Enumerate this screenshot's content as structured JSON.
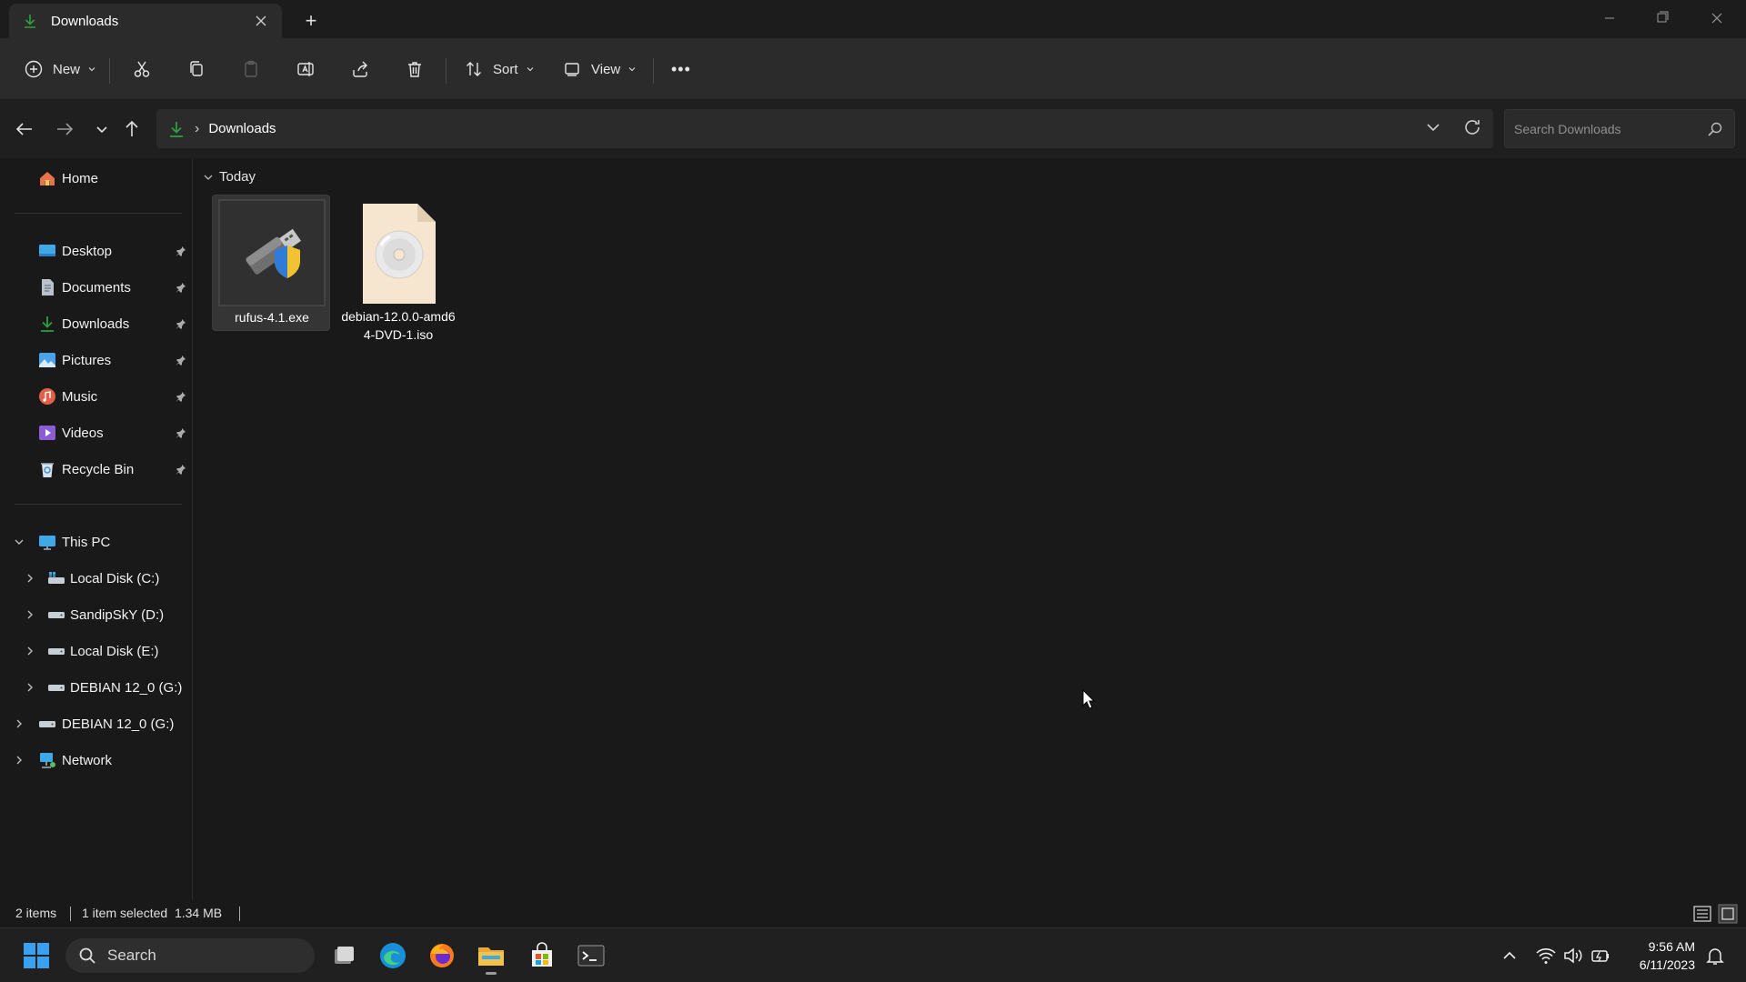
{
  "window": {
    "tab_title": "Downloads",
    "new_tab_label": "+"
  },
  "toolbar": {
    "new_label": "New",
    "sort_label": "Sort",
    "view_label": "View",
    "more_label": "•••"
  },
  "address": {
    "breadcrumb": "Downloads",
    "search_placeholder": "Search Downloads"
  },
  "sidebar": {
    "home": "Home",
    "quick_access": [
      {
        "label": "Desktop",
        "icon": "desktop-icon"
      },
      {
        "label": "Documents",
        "icon": "documents-icon"
      },
      {
        "label": "Downloads",
        "icon": "downloads-icon"
      },
      {
        "label": "Pictures",
        "icon": "pictures-icon"
      },
      {
        "label": "Music",
        "icon": "music-icon"
      },
      {
        "label": "Videos",
        "icon": "videos-icon"
      },
      {
        "label": "Recycle Bin",
        "icon": "recycle-bin-icon"
      }
    ],
    "this_pc": "This PC",
    "drives": [
      {
        "label": "Local Disk (C:)"
      },
      {
        "label": "SandipSkY (D:)"
      },
      {
        "label": "Local Disk (E:)"
      },
      {
        "label": "DEBIAN 12_0 (G:)"
      }
    ],
    "usb_drive": "DEBIAN 12_0 (G:)",
    "network": "Network"
  },
  "content": {
    "group": "Today",
    "files": [
      {
        "name": "rufus-4.1.exe",
        "icon": "usb-shield-icon",
        "selected": true
      },
      {
        "name": "debian-12.0.0-amd64-DVD-1.iso",
        "icon": "disc-image-icon",
        "selected": false
      }
    ]
  },
  "status": {
    "item_count": "2 items",
    "selection": "1 item selected  1.34 MB"
  },
  "taskbar": {
    "search_label": "Search",
    "time": "9:56 AM",
    "date": "6/11/2023"
  },
  "colors": {
    "accent_green": "#2ea043",
    "folder_yellow": "#f2c14e",
    "background": "#191919"
  }
}
